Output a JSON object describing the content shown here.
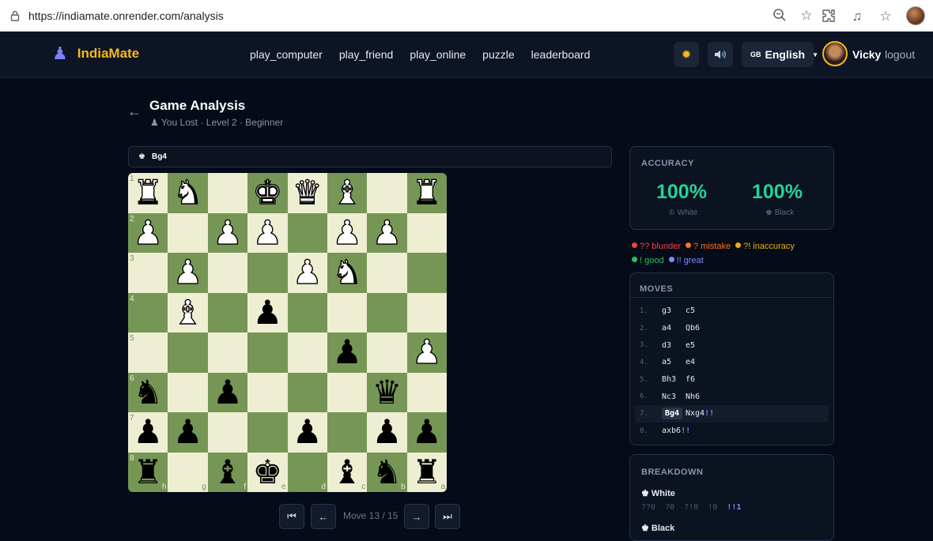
{
  "browser": {
    "url": "https://indiamate.onrender.com/analysis"
  },
  "nav": {
    "brand": "IndiaMate",
    "links": [
      "play_computer",
      "play_friend",
      "play_online",
      "puzzle",
      "leaderboard"
    ],
    "language": "English",
    "language_flag": "GB",
    "username": "Vicky",
    "logout": "logout"
  },
  "header": {
    "title": "Game Analysis",
    "subtitle": "You Lost · Level 2 · Beginner"
  },
  "current_move_banner": "Bg4",
  "board": {
    "ranks": [
      "1",
      "2",
      "3",
      "4",
      "5",
      "6",
      "7",
      "8"
    ],
    "files": [
      "h",
      "g",
      "f",
      "e",
      "d",
      "c",
      "b",
      "a"
    ],
    "rows": [
      [
        "wR",
        "wN",
        "",
        "wK",
        "wQ",
        "wB",
        "",
        "wR"
      ],
      [
        "wP",
        "",
        "wP",
        "wP",
        "",
        "wP",
        "wP",
        ""
      ],
      [
        "",
        "wP",
        "",
        "",
        "wP",
        "wN",
        "",
        ""
      ],
      [
        "",
        "wB",
        "",
        "bP",
        "",
        "",
        "",
        ""
      ],
      [
        "",
        "",
        "",
        "",
        "",
        "bP",
        "",
        "wP"
      ],
      [
        "bN",
        "",
        "bP",
        "",
        "",
        "",
        "bQ",
        ""
      ],
      [
        "bP",
        "bP",
        "",
        "",
        "bP",
        "",
        "bP",
        "bP"
      ],
      [
        "bR",
        "",
        "bB",
        "bK",
        "",
        "bB",
        "bN",
        "bR"
      ]
    ]
  },
  "controls": {
    "move_counter": "Move 13 / 15"
  },
  "accuracy": {
    "title": "ACCURACY",
    "white_value": "100%",
    "white_label": "White",
    "black_value": "100%",
    "black_label": "Black"
  },
  "legend": [
    {
      "label": "?? blunder",
      "color": "#ef4444"
    },
    {
      "label": "? mistake",
      "color": "#f97316"
    },
    {
      "label": "?! inaccuracy",
      "color": "#eab308"
    },
    {
      "label": "! good",
      "color": "#22c55e"
    },
    {
      "label": "!! great",
      "color": "#818cf8"
    }
  ],
  "moves": {
    "title": "MOVES",
    "list": [
      {
        "num": "1.",
        "white": "g3",
        "black": "c5",
        "ann_w": "",
        "ann_b": ""
      },
      {
        "num": "2.",
        "white": "a4",
        "black": "Qb6",
        "ann_w": "",
        "ann_b": ""
      },
      {
        "num": "3.",
        "white": "d3",
        "black": "e5",
        "ann_w": "",
        "ann_b": ""
      },
      {
        "num": "4.",
        "white": "a5",
        "black": "e4",
        "ann_w": "",
        "ann_b": ""
      },
      {
        "num": "5.",
        "white": "Bh3",
        "black": "f6",
        "ann_w": "",
        "ann_b": ""
      },
      {
        "num": "6.",
        "white": "Nc3",
        "black": "Nh6",
        "ann_w": "",
        "ann_b": ""
      },
      {
        "num": "7.",
        "white": "Bg4",
        "black": "Nxg4",
        "ann_w": "",
        "ann_b": "!!"
      },
      {
        "num": "8.",
        "white": "axb6",
        "black": "",
        "ann_w": "!!",
        "ann_b": ""
      }
    ]
  },
  "breakdown": {
    "title": "BREAKDOWN",
    "white_label": "White",
    "white_stats": "??0  ?0  ?!0  !0",
    "white_great": "!!1",
    "black_label": "Black"
  }
}
